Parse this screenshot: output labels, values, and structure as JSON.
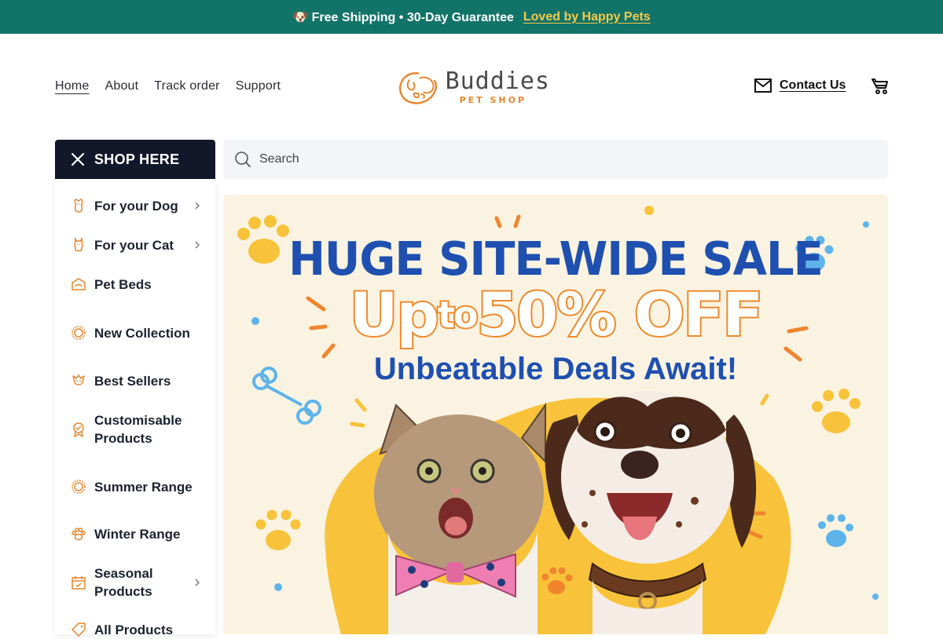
{
  "announcement": {
    "text": "🐶 Free Shipping • 30-Day Guarantee",
    "link": "Loved by Happy Pets"
  },
  "nav": {
    "items": [
      "Home",
      "About",
      "Track order",
      "Support"
    ]
  },
  "logo": {
    "name": "Buddies",
    "sub": "PET SHOP"
  },
  "header": {
    "contact_label": "Contact Us"
  },
  "sidebar": {
    "title": "SHOP HERE",
    "items": [
      {
        "label": "For your Dog",
        "icon": "dog-icon",
        "has_chevron": true
      },
      {
        "label": "For your Cat",
        "icon": "cat-icon",
        "has_chevron": true
      },
      {
        "label": "Pet Beds",
        "icon": "pet-bed-icon",
        "has_chevron": false
      },
      {
        "label": "New Collection",
        "icon": "badge-icon",
        "has_chevron": false
      },
      {
        "label": "Best Sellers",
        "icon": "trophy-dog-icon",
        "has_chevron": false
      },
      {
        "label": "Customisable Products",
        "icon": "ribbon-icon",
        "has_chevron": false
      },
      {
        "label": "Summer Range",
        "icon": "sun-icon",
        "has_chevron": false
      },
      {
        "label": "Winter Range",
        "icon": "paw-icon",
        "has_chevron": false
      },
      {
        "label": "Seasonal Products",
        "icon": "calendar-icon",
        "has_chevron": true
      },
      {
        "label": "All Products",
        "icon": "tag-icon",
        "has_chevron": false
      }
    ]
  },
  "search": {
    "placeholder": "Search"
  },
  "hero": {
    "title": "HUGE SITE-WIDE SALE",
    "offer_up": "Up",
    "offer_to": "to",
    "offer_pct": "50% OFF",
    "subtitle": "Unbeatable Deals Await!"
  },
  "colors": {
    "announce_bg": "#127468",
    "accent_yellow": "#f6c94a",
    "brand_orange": "#e8862c",
    "sidebar_header_bg": "#121829",
    "hero_blue": "#1f50b0"
  }
}
